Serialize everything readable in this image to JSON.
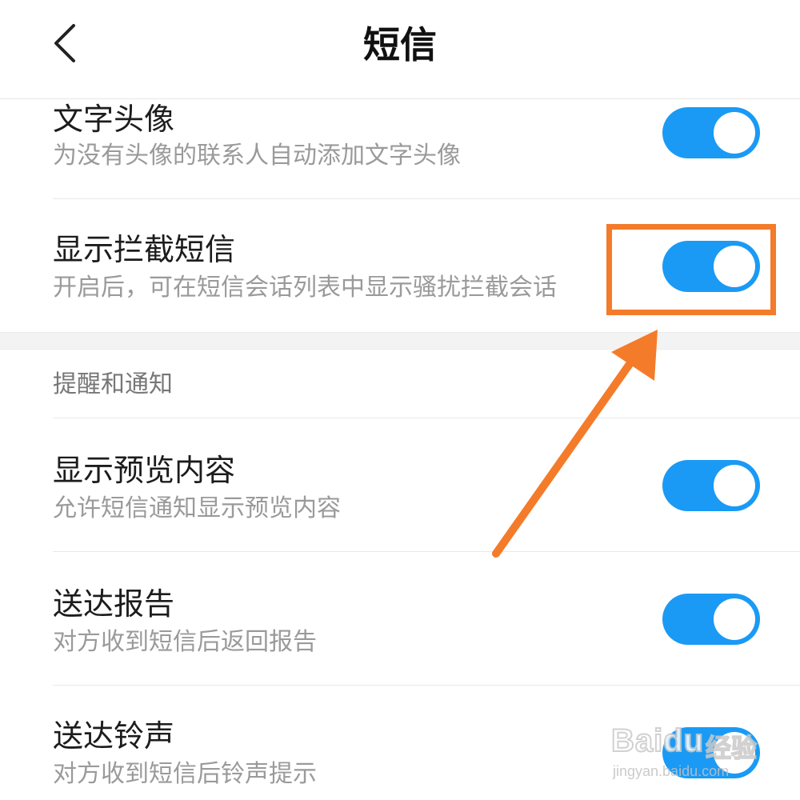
{
  "header": {
    "title": "短信",
    "back_icon": "chevron-left-icon"
  },
  "settings": [
    {
      "id": "text-avatar",
      "title": "文字头像",
      "desc": "为没有头像的联系人自动添加文字头像",
      "enabled": true
    },
    {
      "id": "show-blocked-sms",
      "title": "显示拦截短信",
      "desc": "开启后，可在短信会话列表中显示骚扰拦截会话",
      "enabled": true
    }
  ],
  "section": {
    "title": "提醒和通知"
  },
  "notifications": [
    {
      "id": "show-preview",
      "title": "显示预览内容",
      "desc": "允许短信通知显示预览内容",
      "enabled": true
    },
    {
      "id": "delivery-report",
      "title": "送达报告",
      "desc": "对方收到短信后返回报告",
      "enabled": true
    },
    {
      "id": "delivery-ringtone",
      "title": "送达铃声",
      "desc": "对方收到短信后铃声提示",
      "enabled": true
    }
  ],
  "watermark": {
    "brand": "Baidu",
    "brand_cn": "经验",
    "url": "jingyan.baidu.com"
  },
  "colors": {
    "toggle_on": "#1a9af5",
    "highlight": "#f47b2a"
  }
}
